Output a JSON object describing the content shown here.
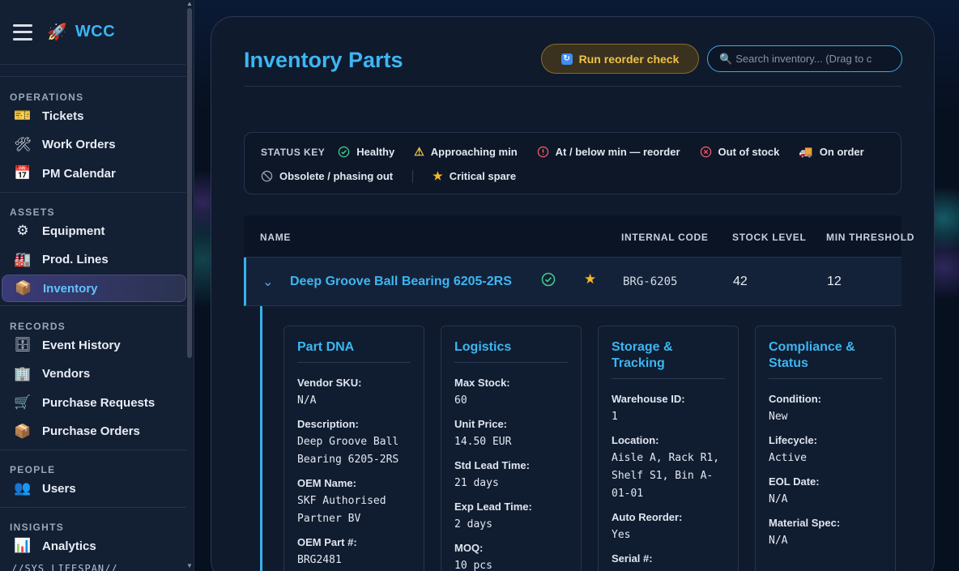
{
  "app": {
    "name": "WCC",
    "logo_icon": "rocket-icon"
  },
  "sidebar": {
    "sections": [
      {
        "label": "OPERATIONS",
        "items": [
          {
            "label": "Tickets",
            "icon": "ticket-icon",
            "glyph": "🎫"
          },
          {
            "label": "Work Orders",
            "icon": "tools-icon",
            "glyph": "🛠"
          },
          {
            "label": "PM Calendar",
            "icon": "calendar-icon",
            "glyph": "📅"
          }
        ]
      },
      {
        "label": "ASSETS",
        "items": [
          {
            "label": "Equipment",
            "icon": "gear-icon",
            "glyph": "⚙"
          },
          {
            "label": "Prod. Lines",
            "icon": "factory-icon",
            "glyph": "🏭"
          },
          {
            "label": "Inventory",
            "icon": "package-icon",
            "glyph": "📦",
            "active": true
          }
        ]
      },
      {
        "label": "RECORDS",
        "items": [
          {
            "label": "Event History",
            "icon": "cabinet-icon",
            "glyph": "🗄"
          },
          {
            "label": "Vendors",
            "icon": "office-building-icon",
            "glyph": "🏢"
          },
          {
            "label": "Purchase Requests",
            "icon": "cart-icon",
            "glyph": "🛒"
          },
          {
            "label": "Purchase Orders",
            "icon": "package-icon",
            "glyph": "📦"
          }
        ]
      },
      {
        "label": "PEOPLE",
        "items": [
          {
            "label": "Users",
            "icon": "users-icon",
            "glyph": "👥"
          }
        ]
      },
      {
        "label": "INSIGHTS",
        "items": [
          {
            "label": "Analytics",
            "icon": "bar-chart-icon",
            "glyph": "📊"
          }
        ]
      }
    ],
    "footer_text": "//SYS_LIFESPAN//"
  },
  "page": {
    "title": "Inventory Parts",
    "reorder_button": "Run reorder check",
    "search_placeholder": "Search inventory... (Drag to c"
  },
  "status_key": {
    "title": "STATUS KEY",
    "row1": [
      {
        "label": "Healthy",
        "icon": "check-circle-icon",
        "glyph": "✓",
        "color": "#3fd18a"
      },
      {
        "label": "Approaching min",
        "icon": "warning-triangle-icon",
        "glyph": "⚠",
        "color": "#f5c542"
      },
      {
        "label": "At / below min — reorder",
        "icon": "alert-circle-icon",
        "glyph": "!",
        "color": "#f05a6a"
      },
      {
        "label": "Out of stock",
        "icon": "x-circle-icon",
        "glyph": "✕",
        "color": "#f05a6a"
      },
      {
        "label": "On order",
        "icon": "truck-icon",
        "glyph": "🚚",
        "color": "#5aa8f5"
      }
    ],
    "row2": [
      {
        "label": "Obsolete / phasing out",
        "icon": "ban-icon",
        "glyph": "⃠",
        "color": "#9aa4b4"
      },
      {
        "label": "Critical spare",
        "icon": "star-icon",
        "glyph": "★",
        "color": "#f5b82a"
      }
    ]
  },
  "table": {
    "columns": [
      "NAME",
      "INTERNAL CODE",
      "STOCK LEVEL",
      "MIN THRESHOLD"
    ],
    "row": {
      "name": "Deep Groove Ball Bearing 6205-2RS",
      "status_icon": "check-circle-icon",
      "critical_icon": "star-icon",
      "internal_code": "BRG-6205",
      "stock_level": "42",
      "min_threshold": "12"
    }
  },
  "details": [
    {
      "title": "Part DNA",
      "fields": [
        {
          "label": "Vendor SKU:",
          "value": "N/A"
        },
        {
          "label": "Description:",
          "value": "Deep Groove Ball Bearing 6205-2RS"
        },
        {
          "label": "OEM Name:",
          "value": "SKF Authorised Partner BV"
        },
        {
          "label": "OEM Part #:",
          "value": "BRG2481"
        }
      ]
    },
    {
      "title": "Logistics",
      "fields": [
        {
          "label": "Max Stock:",
          "value": "60"
        },
        {
          "label": "Unit Price:",
          "value": "14.50 EUR"
        },
        {
          "label": "Std Lead Time:",
          "value": "21 days"
        },
        {
          "label": "Exp Lead Time:",
          "value": "2 days"
        },
        {
          "label": "MOQ:",
          "value": "10 pcs"
        }
      ]
    },
    {
      "title": "Storage & Tracking",
      "fields": [
        {
          "label": "Warehouse ID:",
          "value": "1"
        },
        {
          "label": "Location:",
          "value": "Aisle A, Rack R1, Shelf S1, Bin A-01-01"
        },
        {
          "label": "Auto Reorder:",
          "value": "Yes"
        },
        {
          "label": "Serial #:",
          "value": ""
        }
      ]
    },
    {
      "title": "Compliance & Status",
      "fields": [
        {
          "label": "Condition:",
          "value": "New"
        },
        {
          "label": "Lifecycle:",
          "value": "Active"
        },
        {
          "label": "EOL Date:",
          "value": "N/A"
        },
        {
          "label": "Material Spec:",
          "value": "N/A"
        }
      ]
    }
  ]
}
